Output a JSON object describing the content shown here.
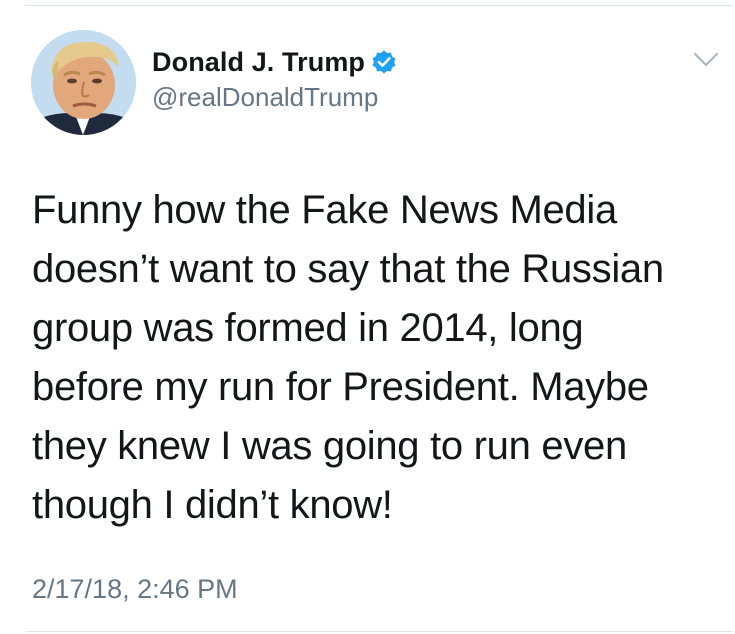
{
  "tweet": {
    "display_name": "Donald J. Trump",
    "handle": "@realDonaldTrump",
    "verified": true,
    "text_lines": [
      "Funny how the Fake News Media",
      "doesn’t want to say that the Russian",
      "group was formed in 2014, long",
      "before my run for President. Maybe",
      "they knew I was going to run even",
      "though I didn’t know!"
    ],
    "timestamp": "2/17/18, 2:46 PM"
  },
  "colors": {
    "verified_badge": "#1da1f2",
    "text_primary": "#14171a",
    "text_secondary": "#657786",
    "divider": "#dde3e8"
  },
  "icons": {
    "verified": "verified-badge-icon",
    "menu": "chevron-down-icon"
  }
}
